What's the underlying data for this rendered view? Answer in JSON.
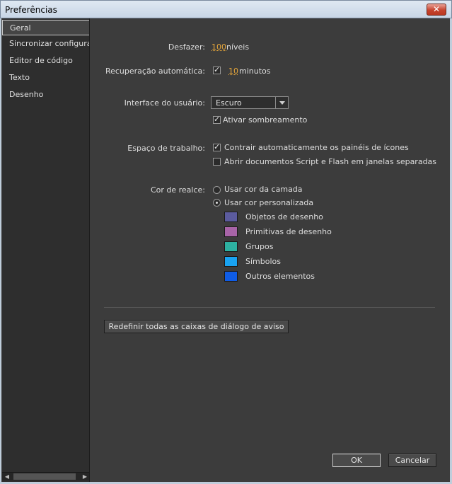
{
  "window": {
    "title": "Preferências",
    "close_glyph": "✕"
  },
  "sidebar": {
    "items": [
      {
        "label": "Geral",
        "selected": true
      },
      {
        "label": "Sincronizar configurações"
      },
      {
        "label": "Editor de código"
      },
      {
        "label": "Texto"
      },
      {
        "label": "Desenho"
      }
    ]
  },
  "general": {
    "undo": {
      "label": "Desfazer:",
      "value": "100",
      "unit": "níveis"
    },
    "autosave": {
      "label": "Recuperação automática:",
      "checked": true,
      "value": "10",
      "unit": "minutos"
    },
    "ui": {
      "label": "Interface do usuário:",
      "theme": "Escuro",
      "shading_label": "Ativar sombreamento",
      "shading_checked": true
    },
    "workspace": {
      "label": "Espaço de trabalho:",
      "collapse_label": "Contrair automaticamente os painéis de ícones",
      "collapse_checked": true,
      "separate_label": "Abrir documentos Script e Flash em janelas separadas",
      "separate_checked": false
    },
    "highlight": {
      "label": "Cor de realce:",
      "layer_label": "Usar cor da camada",
      "custom_label": "Usar cor personalizada",
      "custom_selected": true,
      "colors": [
        {
          "label": "Objetos de desenho",
          "color": "#5b5b9e"
        },
        {
          "label": "Primitivas de desenho",
          "color": "#a864a8"
        },
        {
          "label": "Grupos",
          "color": "#2db1a1"
        },
        {
          "label": "Símbolos",
          "color": "#19a3f2"
        },
        {
          "label": "Outros elementos",
          "color": "#0f5ce6"
        }
      ]
    },
    "reset_button": "Redefinir todas as caixas de diálogo de aviso"
  },
  "footer": {
    "ok": "OK",
    "cancel": "Cancelar"
  }
}
